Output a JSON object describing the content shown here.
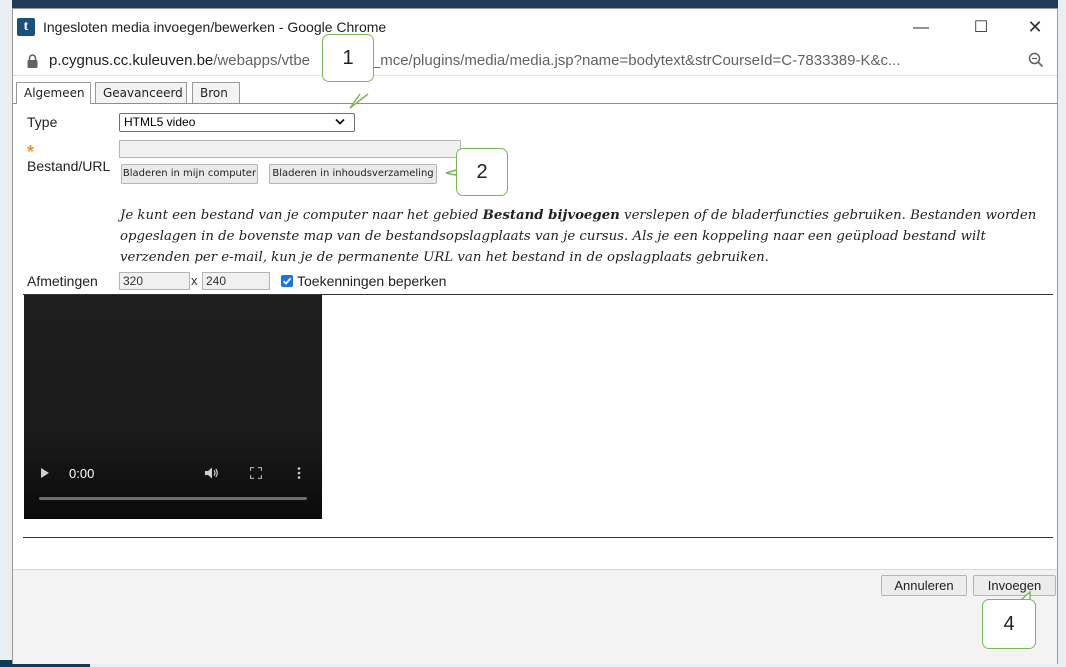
{
  "window": {
    "title": "Ingesloten media invoegen/bewerken - Google Chrome",
    "app_icon": "t",
    "minimize_icon": "—",
    "maximize_icon": "☐",
    "close_icon": "✕"
  },
  "address": {
    "host": "p.cygnus.cc.kuleuven.be",
    "path_before": "/webapps/vtbe",
    "path_after": "e/tiny_mce/plugins/media/media.jsp?name=bodytext&strCourseId=C-7833389-K&c..."
  },
  "tabs": [
    {
      "label": "Algemeen",
      "active": true
    },
    {
      "label": "Geavanceerd",
      "active": false
    },
    {
      "label": "Bron",
      "active": false
    }
  ],
  "form": {
    "type_label": "Type",
    "type_value": "HTML5 video",
    "required_mark": "*",
    "file_label": "Bestand/URL",
    "file_value": "",
    "browse_computer_label": "Bladeren in mijn computer",
    "browse_repository_label": "Bladeren in inhoudsverzameling",
    "help_part1": "Je kunt een bestand van je computer naar het gebied ",
    "help_bold": "Bestand bijvoegen",
    "help_part2": " verslepen of de bladerfuncties gebruiken. Bestanden worden opgeslagen in de bovenste map van de bestandsopslagplaats van je cursus. Als je een koppeling naar een geüpload bestand wilt verzenden per e-mail, kun je de permanente URL van het bestand in de opslagplaats gebruiken.",
    "dimensions_label": "Afmetingen",
    "width_value": "320",
    "dim_separator": "x",
    "height_value": "240",
    "constrain_label": "Toekenningen beperken",
    "constrain_checked": true
  },
  "video": {
    "time": "0:00"
  },
  "footer": {
    "cancel_label": "Annuleren",
    "insert_label": "Invoegen"
  },
  "callouts": {
    "c1": "1",
    "c2": "2",
    "c4": "4"
  },
  "colors": {
    "callout_border": "#7cb65a",
    "required_star": "#f0932a",
    "checkbox": "#1a73e8"
  }
}
